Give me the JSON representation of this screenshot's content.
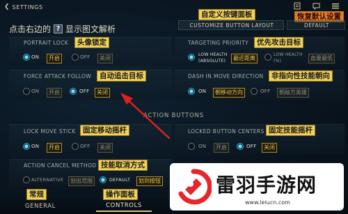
{
  "header": {
    "back_label": "SETTINGS",
    "tip_prefix": "点击右边的",
    "tip_suffix": "显示图文解析",
    "tip_icon": "?",
    "custom_title_anno": "自定义按键面板",
    "restore_anno": "恢复默认设置",
    "tab_customize": "CUSTOMIZE BUTTON LAYOUT",
    "tab_default": "DEFAULT"
  },
  "top_icons": [
    "note-icon",
    "chat-icon",
    "menu-icon"
  ],
  "settings": {
    "portrait_lock": {
      "label": "PORTRAIT LOCK",
      "anno": "头像锁定",
      "on": "ON",
      "off": "OFF",
      "on_cn": "开启",
      "off_cn": "关闭",
      "selected": "on"
    },
    "targeting_priority": {
      "label": "TARGETING PRIORITY",
      "anno": "优先攻击目标",
      "opt1": "LOW HEALTH",
      "opt1_sub": "(ABSOLUTE)",
      "opt1_cn": "最近距离",
      "opt2": "LOW HEALTH",
      "opt2_sub": "(%)",
      "opt2_cn": "血量最低",
      "selected": "opt1"
    },
    "force_attack_follow": {
      "label": "FORCE ATTACK FOLLOW",
      "anno": "自动追击目标",
      "on": "ON",
      "off": "OFF",
      "on_cn": "开启",
      "off_cn": "关闭",
      "selected": "off"
    },
    "dash_direction": {
      "label": "DASH IN MOVE DIRECTION",
      "anno": "非指向性技能朝向",
      "on": "ON",
      "off": "OFF",
      "on_cn": "朝移动方向",
      "off_cn": "朝敌方英雄",
      "selected": "on"
    },
    "section_title": "ACTION BUTTONS",
    "lock_move_stick": {
      "label": "LOCK MOVE STICK",
      "anno": "固定移动摇杆",
      "on": "ON",
      "off": "OFF",
      "on_cn": "开启",
      "off_cn": "关闭",
      "selected": "on"
    },
    "locked_button_centers": {
      "label": "LOCKED BUTTON CENTERS",
      "anno": "固定技能摇杆",
      "on": "ON",
      "off": "OFF",
      "on_cn": "开启",
      "off_cn": "关闭",
      "selected": "off"
    },
    "action_cancel_method": {
      "label": "ACTION CANCEL METHOD",
      "anno": "技能取消方式",
      "opt1": "ALTERNATIVE",
      "opt1_cn": "划出范围",
      "opt2": "DEFAULT",
      "opt2_cn": "划到按钮",
      "selected": "opt2"
    }
  },
  "bottom_tabs": {
    "general": "GENERAL",
    "general_anno": "常规",
    "controls": "CONTROLS",
    "controls_anno": "操作面板"
  },
  "watermark": {
    "site_name": "雷羽手游网",
    "url": "www.leiucn.com"
  },
  "colors": {
    "annotation_bg": "#f2d25a",
    "radio_active": "#3aa7c9",
    "arrow": "#e0201f",
    "gold_text": "#d9c48a"
  }
}
